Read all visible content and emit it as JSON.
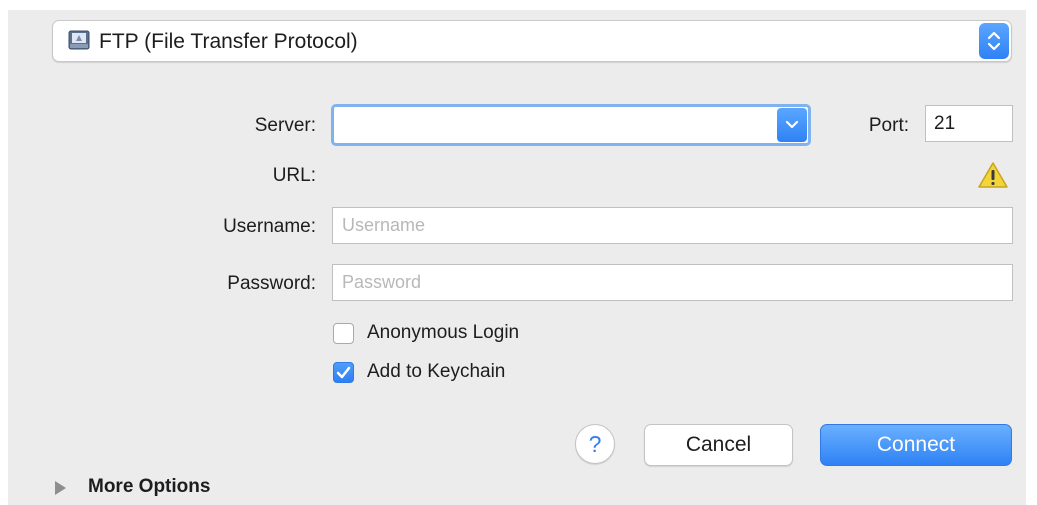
{
  "protocol": {
    "selected": "FTP (File Transfer Protocol)",
    "icon": "ftp-drive-icon"
  },
  "server": {
    "label": "Server:",
    "value": ""
  },
  "port": {
    "label": "Port:",
    "value": "21"
  },
  "url": {
    "label": "URL:",
    "value": ""
  },
  "username": {
    "label": "Username:",
    "value": "",
    "placeholder": "Username"
  },
  "password": {
    "label": "Password:",
    "value": "",
    "placeholder": "Password"
  },
  "options": {
    "anonymous_login": {
      "label": "Anonymous Login",
      "checked": false
    },
    "add_to_keychain": {
      "label": "Add to Keychain",
      "checked": true
    }
  },
  "buttons": {
    "help": "?",
    "cancel": "Cancel",
    "connect": "Connect"
  },
  "more_options": {
    "label": "More Options",
    "expanded": false
  },
  "colors": {
    "accent": "#2f82f5",
    "panel_background": "#ececec",
    "warning": "#f2d53a"
  }
}
